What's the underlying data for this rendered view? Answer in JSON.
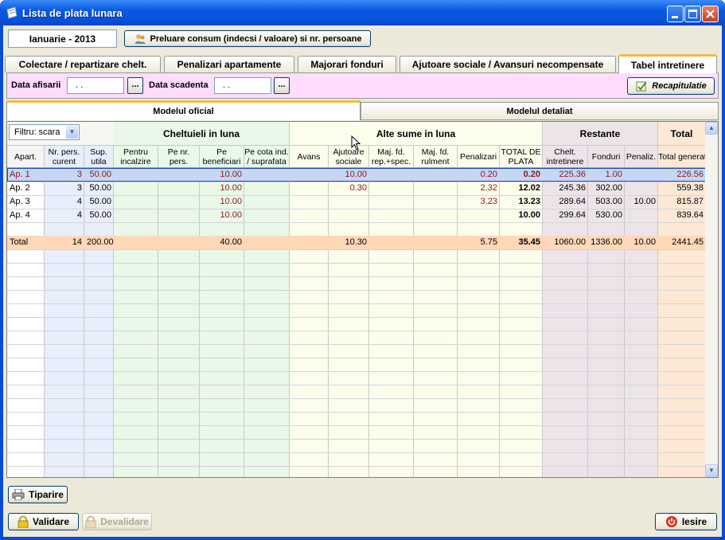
{
  "window": {
    "title": "Lista de plata lunara"
  },
  "toolbar": {
    "month": "Ianuarie - 2013",
    "consum_button": "Preluare consum (indecsi / valoare) si nr. persoane"
  },
  "tabs": [
    {
      "label": "Colectare / repartizare chelt."
    },
    {
      "label": "Penalizari apartamente"
    },
    {
      "label": "Majorari fonduri"
    },
    {
      "label": "Ajutoare sociale / Avansuri necompensate"
    },
    {
      "label": "Tabel intretinere"
    }
  ],
  "filters": {
    "data_afisarii_label": "Data afisarii",
    "data_afisarii_value": ". .",
    "data_scadenta_label": "Data scadenta",
    "data_scadenta_value": ". .",
    "picker_label": "...",
    "recap_button": "Recapitulatie"
  },
  "subtabs": {
    "oficial": "Modelul oficial",
    "detaliat": "Modelul detaliat"
  },
  "grid": {
    "filter_label": "Filtru: scara",
    "groups": [
      "Cheltuieli in luna",
      "Alte sume in luna",
      "Restante",
      "Total"
    ],
    "columns": [
      {
        "l1": "Apart.",
        "l2": ""
      },
      {
        "l1": "Nr. pers.",
        "l2": "curent"
      },
      {
        "l1": "Sup.",
        "l2": "utila"
      },
      {
        "l1": "Pentru",
        "l2": "incalzire"
      },
      {
        "l1": "Pe nr.",
        "l2": "pers."
      },
      {
        "l1": "Pe",
        "l2": "beneficiari"
      },
      {
        "l1": "Pe cota ind.",
        "l2": "/ suprafata"
      },
      {
        "l1": "Avans",
        "l2": ""
      },
      {
        "l1": "Ajutoare",
        "l2": "sociale"
      },
      {
        "l1": "Maj. fd.",
        "l2": "rep.+spec."
      },
      {
        "l1": "Maj. fd.",
        "l2": "rulment"
      },
      {
        "l1": "Penalizari",
        "l2": ""
      },
      {
        "l1": "TOTAL DE",
        "l2": "PLATA"
      },
      {
        "l1": "Chelt.",
        "l2": "intretinere"
      },
      {
        "l1": "Fonduri",
        "l2": ""
      },
      {
        "l1": "Penaliz.",
        "l2": ""
      },
      {
        "l1": "Total generat",
        "l2": ""
      }
    ],
    "rows": [
      [
        "Ap. 1",
        "3",
        "50.00",
        "",
        "",
        "10.00",
        "",
        "",
        "10.00",
        "",
        "",
        "0.20",
        "0.20",
        "225.36",
        "1.00",
        "",
        "226.56"
      ],
      [
        "Ap. 2",
        "3",
        "50.00",
        "",
        "",
        "10.00",
        "",
        "",
        "0.30",
        "",
        "",
        "2.32",
        "12.02",
        "245.36",
        "302.00",
        "",
        "559.38"
      ],
      [
        "Ap. 3",
        "4",
        "50.00",
        "",
        "",
        "10.00",
        "",
        "",
        "",
        "",
        "",
        "3.23",
        "13.23",
        "289.64",
        "503.00",
        "10.00",
        "815.87"
      ],
      [
        "Ap. 4",
        "4",
        "50.00",
        "",
        "",
        "10.00",
        "",
        "",
        "",
        "",
        "",
        "",
        "10.00",
        "299.64",
        "530.00",
        "",
        "839.64"
      ]
    ],
    "total_row": [
      "Total",
      "14",
      "200.00",
      "",
      "",
      "40.00",
      "",
      "",
      "10.30",
      "",
      "",
      "5.75",
      "35.45",
      "1060.00",
      "1336.00",
      "10.00",
      "2441.45"
    ]
  },
  "footer": {
    "print": "Tiparire",
    "validate": "Validare",
    "devalidate": "Devalidare",
    "exit": "Iesire"
  },
  "colors": {
    "green_bg": "#e9f8e9",
    "yellow_bg": "#fdfdec",
    "pink_bg": "#ede4ea",
    "orange_bg": "#fde8d6",
    "blue_bg": "#e8eefb",
    "total_row": "#ffd8b8",
    "selected_row": "#c6d6f4"
  }
}
